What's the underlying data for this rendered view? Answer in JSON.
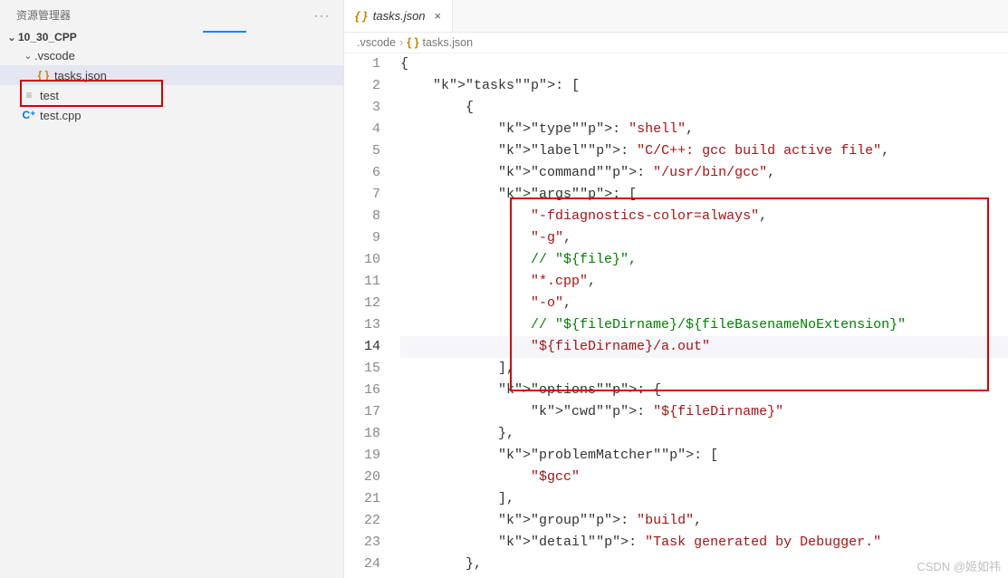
{
  "sidebar": {
    "title": "资源管理器",
    "more": "···",
    "project": "10_30_CPP",
    "items": [
      {
        "label": ".vscode",
        "type": "folder"
      },
      {
        "label": "tasks.json",
        "type": "json"
      },
      {
        "label": "test",
        "type": "blank"
      },
      {
        "label": "test.cpp",
        "type": "cpp"
      }
    ]
  },
  "tab": {
    "icon": "{ }",
    "label": "tasks.json",
    "close": "×"
  },
  "breadcrumb": {
    "part1": ".vscode",
    "sep": "›",
    "icon": "{ }",
    "part2": "tasks.json"
  },
  "code": {
    "lines": [
      "{",
      "    \"tasks\": [",
      "        {",
      "            \"type\": \"shell\",",
      "            \"label\": \"C/C++: gcc build active file\",",
      "            \"command\": \"/usr/bin/gcc\",",
      "            \"args\": [",
      "                \"-fdiagnostics-color=always\",",
      "                \"-g\",",
      "                // \"${file}\",",
      "                \"*.cpp\",",
      "                \"-o\",",
      "                // \"${fileDirname}/${fileBasenameNoExtension}\"",
      "                \"${fileDirname}/a.out\"",
      "            ],",
      "            \"options\": {",
      "                \"cwd\": \"${fileDirname}\"",
      "            },",
      "            \"problemMatcher\": [",
      "                \"$gcc\"",
      "            ],",
      "            \"group\": \"build\",",
      "            \"detail\": \"Task generated by Debugger.\"",
      "        },"
    ],
    "current_line": 14
  },
  "watermark": "CSDN @姬如祎"
}
